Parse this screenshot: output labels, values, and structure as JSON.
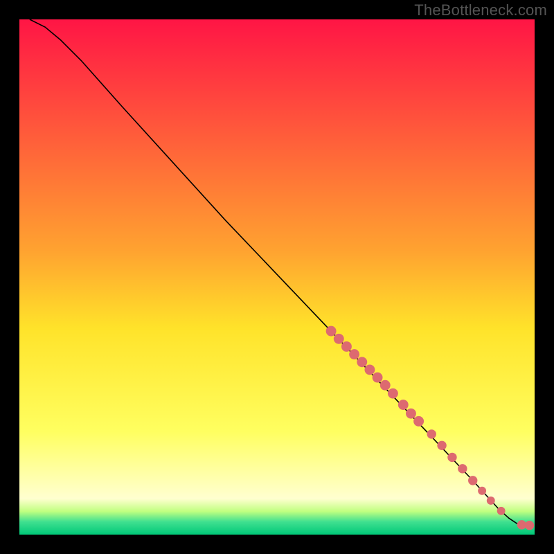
{
  "watermark": {
    "text": "TheBottleneck.com"
  },
  "chart_data": {
    "type": "line",
    "title": "",
    "xlabel": "",
    "ylabel": "",
    "xlim": [
      0,
      100
    ],
    "ylim": [
      0,
      100
    ],
    "grid": false,
    "legend": false,
    "background": {
      "kind": "vertical-gradient",
      "stops": [
        {
          "offset": 0.0,
          "color": "#ff1545"
        },
        {
          "offset": 0.45,
          "color": "#ffa330"
        },
        {
          "offset": 0.6,
          "color": "#ffe32a"
        },
        {
          "offset": 0.8,
          "color": "#ffff60"
        },
        {
          "offset": 0.93,
          "color": "#ffffd0"
        },
        {
          "offset": 0.955,
          "color": "#c0ff80"
        },
        {
          "offset": 0.975,
          "color": "#40e090"
        },
        {
          "offset": 1.0,
          "color": "#00c878"
        }
      ]
    },
    "series": [
      {
        "name": "curve",
        "kind": "line",
        "color": "#000000",
        "x": [
          2,
          5,
          8,
          12,
          20,
          30,
          40,
          50,
          60,
          70,
          80,
          88,
          93,
          95,
          96.5,
          98,
          99
        ],
        "y": [
          100,
          98.5,
          96,
          92,
          83,
          72,
          61,
          50.5,
          40,
          29.5,
          19,
          10.5,
          5,
          3.2,
          2.2,
          1.8,
          1.8
        ]
      },
      {
        "name": "markers",
        "kind": "scatter",
        "color": "#dd6a70",
        "note": "highlighted points along the curve, lower-right segment",
        "points": [
          {
            "x": 60.5,
            "y": 39.5,
            "r": 1.0
          },
          {
            "x": 62.0,
            "y": 38.0,
            "r": 1.0
          },
          {
            "x": 63.5,
            "y": 36.5,
            "r": 1.0
          },
          {
            "x": 65.0,
            "y": 35.0,
            "r": 1.0
          },
          {
            "x": 66.5,
            "y": 33.5,
            "r": 1.0
          },
          {
            "x": 68.0,
            "y": 32.0,
            "r": 1.0
          },
          {
            "x": 69.5,
            "y": 30.5,
            "r": 1.0
          },
          {
            "x": 71.0,
            "y": 29.0,
            "r": 1.0
          },
          {
            "x": 72.5,
            "y": 27.4,
            "r": 1.0
          },
          {
            "x": 74.5,
            "y": 25.2,
            "r": 1.0
          },
          {
            "x": 76.0,
            "y": 23.5,
            "r": 1.0
          },
          {
            "x": 77.5,
            "y": 22.0,
            "r": 1.0
          },
          {
            "x": 80.0,
            "y": 19.5,
            "r": 0.9
          },
          {
            "x": 82.0,
            "y": 17.3,
            "r": 0.9
          },
          {
            "x": 84.0,
            "y": 15.0,
            "r": 0.9
          },
          {
            "x": 86.0,
            "y": 12.8,
            "r": 0.9
          },
          {
            "x": 88.0,
            "y": 10.5,
            "r": 0.9
          },
          {
            "x": 89.8,
            "y": 8.5,
            "r": 0.8
          },
          {
            "x": 91.5,
            "y": 6.6,
            "r": 0.8
          },
          {
            "x": 93.5,
            "y": 4.6,
            "r": 0.8
          },
          {
            "x": 97.5,
            "y": 1.9,
            "r": 0.9
          },
          {
            "x": 99.0,
            "y": 1.8,
            "r": 0.9
          }
        ]
      }
    ]
  }
}
